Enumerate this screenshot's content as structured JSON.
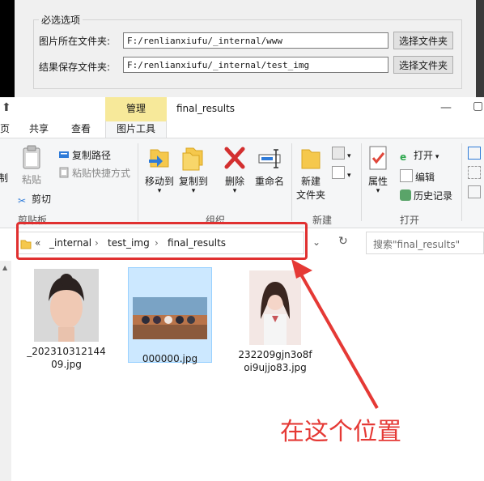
{
  "dialog": {
    "group_title": "必选选项",
    "rows": [
      {
        "label": "图片所在文件夹:",
        "value": "F:/renlianxiufu/_internal/www",
        "button": "选择文件夹"
      },
      {
        "label": "结果保存文件夹:",
        "value": "F:/renlianxiufu/_internal/test_img",
        "button": "选择文件夹"
      }
    ]
  },
  "explorer": {
    "manage_tab": "管理",
    "window_title": "final_results",
    "tabs": [
      "页",
      "共享",
      "查看",
      "图片工具"
    ],
    "ribbon": {
      "clipboard": {
        "cut_partial": "制",
        "paste": "粘贴",
        "copy_path": "复制路径",
        "paste_shortcut": "粘贴快捷方式",
        "cut": "剪切",
        "label": "剪贴板"
      },
      "organize": {
        "move_to": "移动到",
        "copy_to": "复制到",
        "delete": "删除",
        "rename": "重命名",
        "label": "组织"
      },
      "new": {
        "new_folder_line1": "新建",
        "new_folder_line2": "文件夹",
        "label": "新建"
      },
      "open": {
        "properties": "属性",
        "open": "打开",
        "edit": "编辑",
        "history": "历史记录",
        "label": "打开"
      }
    },
    "address": {
      "prefix": "«",
      "crumbs": [
        "_internal",
        "test_img",
        "final_results"
      ]
    },
    "search_placeholder": "搜索\"final_results\"",
    "files": [
      {
        "name_line1": "_202310312144",
        "name_line2": "09.jpg",
        "selected": false
      },
      {
        "name_line1": "000000.jpg",
        "name_line2": "",
        "selected": true
      },
      {
        "name_line1": "232209gjn3o8f",
        "name_line2": "oi9ujjo83.jpg",
        "selected": false
      }
    ]
  },
  "annotation": {
    "text": "在这个位置",
    "color": "#e53935"
  },
  "colors": {
    "highlight": "#e03030",
    "manage_tab": "#f7e99a",
    "selection": "#cce8ff"
  }
}
